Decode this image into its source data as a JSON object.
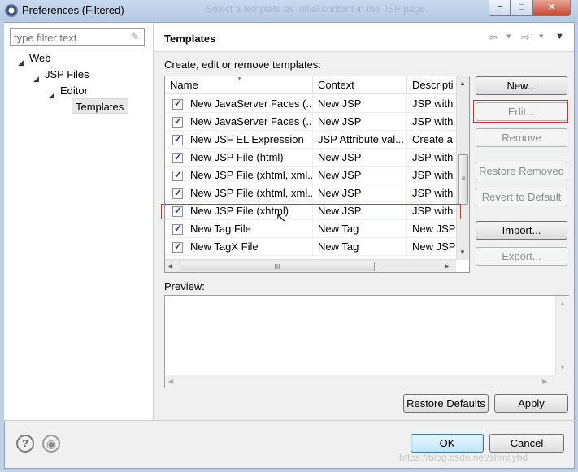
{
  "window": {
    "title": "Preferences (Filtered)",
    "background_hint": "Select a template as initial content in the JSP page.",
    "controls": {
      "minimize": "−",
      "maximize": "□",
      "close": "✕"
    }
  },
  "filter": {
    "placeholder": "type filter text",
    "value": ""
  },
  "tree": [
    {
      "label": "Web",
      "level": 0,
      "expanded": true
    },
    {
      "label": "JSP Files",
      "level": 1,
      "expanded": true
    },
    {
      "label": "Editor",
      "level": 2,
      "expanded": true
    },
    {
      "label": "Templates",
      "level": 3,
      "selected": true
    }
  ],
  "page": {
    "title": "Templates",
    "description": "Create, edit or remove templates:",
    "preview_label": "Preview:"
  },
  "table": {
    "columns": [
      "Name",
      "Context",
      "Descripti"
    ],
    "rows": [
      {
        "checked": true,
        "name": "New JavaServer Faces (...",
        "context": "New JSP",
        "description": "JSP with x"
      },
      {
        "checked": true,
        "name": "New JavaServer Faces (...",
        "context": "New JSP",
        "description": "JSP with J"
      },
      {
        "checked": true,
        "name": "New JSF EL Expression",
        "context": "JSP Attribute val...",
        "description": "Create a"
      },
      {
        "checked": true,
        "name": "New JSP File (html)",
        "context": "New JSP",
        "description": "JSP with h"
      },
      {
        "checked": true,
        "name": "New JSP File (xhtml, xml...",
        "context": "New JSP",
        "description": "JSP with J"
      },
      {
        "checked": true,
        "name": "New JSP File (xhtml, xml...",
        "context": "New JSP",
        "description": "JSP with J"
      },
      {
        "checked": true,
        "name": "New JSP File (xhtml)",
        "context": "New JSP",
        "description": "JSP with x"
      },
      {
        "checked": true,
        "name": "New Tag File",
        "context": "New Tag",
        "description": "New JSP"
      },
      {
        "checked": true,
        "name": "New TagX File",
        "context": "New Tag",
        "description": "New JSP"
      }
    ],
    "scroll_labels": {
      "up": "▲",
      "down": "▼",
      "left": "◀",
      "right": "▶",
      "grip_v": "≡",
      "grip_h": "III"
    }
  },
  "buttons": {
    "new": "New...",
    "edit": "Edit...",
    "remove": "Remove",
    "restore_removed": "Restore Removed",
    "revert_to_default": "Revert to Default",
    "import": "Import...",
    "export": "Export...",
    "restore_defaults": "Restore Defaults",
    "apply": "Apply",
    "ok": "OK",
    "cancel": "Cancel"
  },
  "footer": {
    "help_icon": "?",
    "record_icon": "◉"
  },
  "nav": {
    "back": "⇦",
    "forward": "⇨",
    "dropdown": "▾",
    "menu": "▼"
  },
  "watermark": "https://blog.csdn.net/shmilyhd",
  "colors": {
    "annotation": "#d9302a",
    "ok_border": "#3c7fb1",
    "title_bar": "#c9d9ee"
  }
}
